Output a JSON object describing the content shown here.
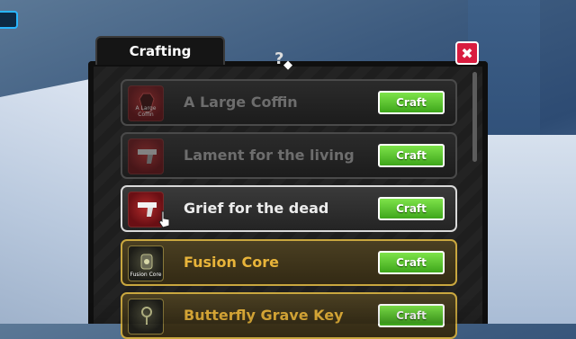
{
  "window": {
    "title": "Crafting",
    "help_symbol": "?",
    "help_diamond": "◆",
    "close_symbol": "✖"
  },
  "recipes": [
    {
      "name": "A Large Coffin",
      "thumb_label": "A Large Coffin",
      "thumb_icon": "coffin-icon",
      "state": "dim",
      "button": "Craft"
    },
    {
      "name": "Lament for the living",
      "thumb_label": "",
      "thumb_icon": "pistol-icon",
      "state": "dim",
      "button": "Craft"
    },
    {
      "name": "Grief for the dead",
      "thumb_label": "",
      "thumb_icon": "pistol-icon",
      "state": "selected",
      "button": "Craft"
    },
    {
      "name": "Fusion Core",
      "thumb_label": "Fusion Core",
      "thumb_icon": "fusion-core-icon",
      "state": "gold",
      "button": "Craft"
    },
    {
      "name": "Butterfly Grave Key",
      "thumb_label": "",
      "thumb_icon": "grave-key-icon",
      "state": "gold",
      "button": "Craft"
    }
  ],
  "colors": {
    "craft_green": "#3ea61b",
    "close_red": "#d91c3f",
    "gold_border": "#c9a73f",
    "gold_text": "#e8b43a"
  }
}
